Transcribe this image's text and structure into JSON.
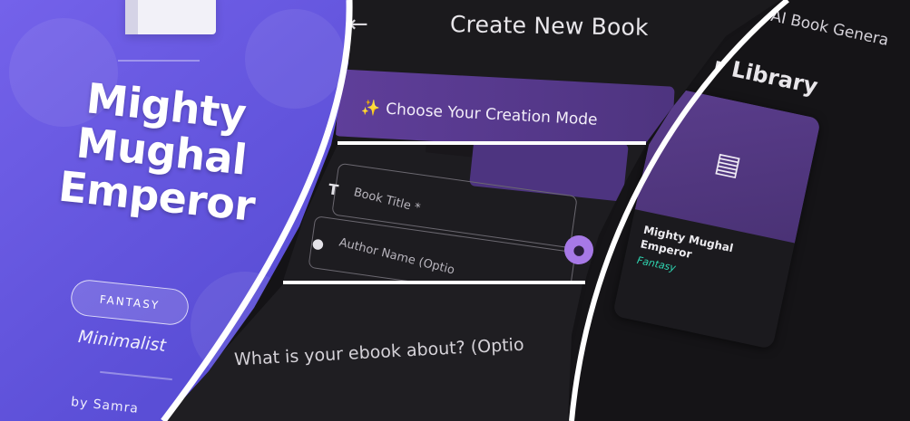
{
  "cover": {
    "title_line1": "Mighty",
    "title_line2": "Mughal",
    "title_line3": "Emperor",
    "genre": "FANTASY",
    "style": "Minimalist",
    "author": "by Samra"
  },
  "create_book": {
    "back_icon": "arrow-left-icon",
    "title": "Create New Book",
    "mode_banner": "Choose Your Creation Mode",
    "sparkle": "✨",
    "fields": {
      "book_title_placeholder": "Book Title *",
      "author_placeholder": "Author Name (Optio"
    },
    "idea_button_icon": "lightbulb-icon",
    "prompt_label": "What is your ebook about? (Optio"
  },
  "library": {
    "app_name": "AI Book Genera",
    "section_title": "r Library",
    "books": [
      {
        "title": "Mighty Mughal Emperor",
        "genre": "Fantasy",
        "icon": "book-open-icon"
      }
    ]
  },
  "colors": {
    "cover_purple": "#5a4ed6",
    "banner_purple": "#5f3e9a",
    "genre_teal": "#2fd6b2",
    "dark_bg": "#141316"
  }
}
